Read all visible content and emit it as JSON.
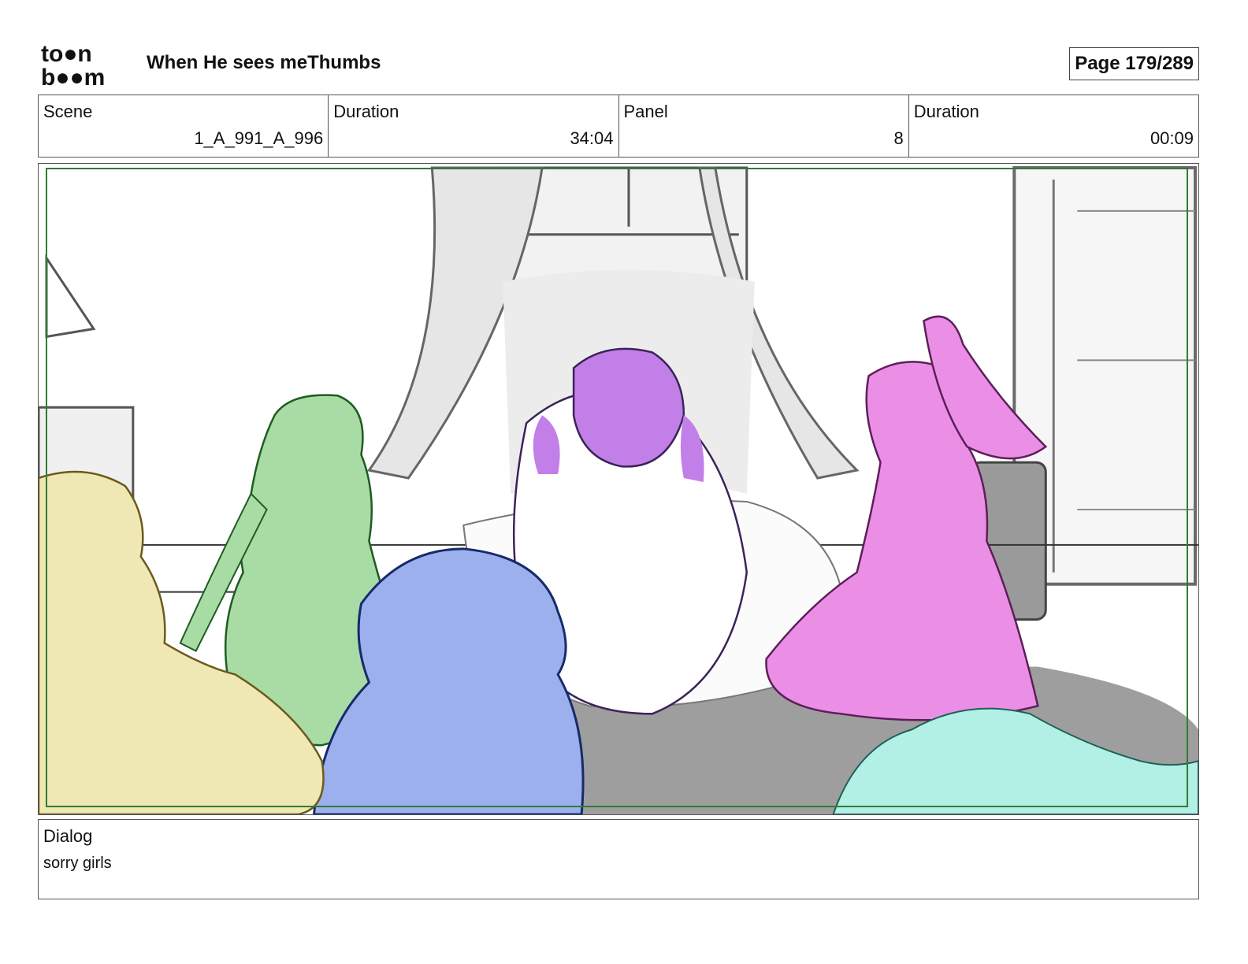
{
  "header": {
    "logo_top": "to●n",
    "logo_bottom": "b●●m",
    "title": "When He sees meThumbs",
    "page": "Page 179/289"
  },
  "info": {
    "scene_label": "Scene",
    "scene_value": "1_A_991_A_996",
    "duration_label": "Duration",
    "duration_value": "34:04",
    "panel_label": "Panel",
    "panel_value": "8",
    "panel_duration_label": "Duration",
    "panel_duration_value": "00:09"
  },
  "panel": {
    "icon": "storyboard-sketch-image",
    "colors": {
      "yellow_figure": "#efe7b4",
      "green_figure": "#a9dca4",
      "blue_figure": "#9bb0ec",
      "purple_figure": "#c27fe8",
      "pink_figure": "#eb8fe6",
      "cyan_figure": "#b2efe5",
      "floor_rug": "#9e9e9e",
      "frame_line": "#2e7d32"
    }
  },
  "dialog": {
    "label": "Dialog",
    "text": "sorry girls"
  }
}
